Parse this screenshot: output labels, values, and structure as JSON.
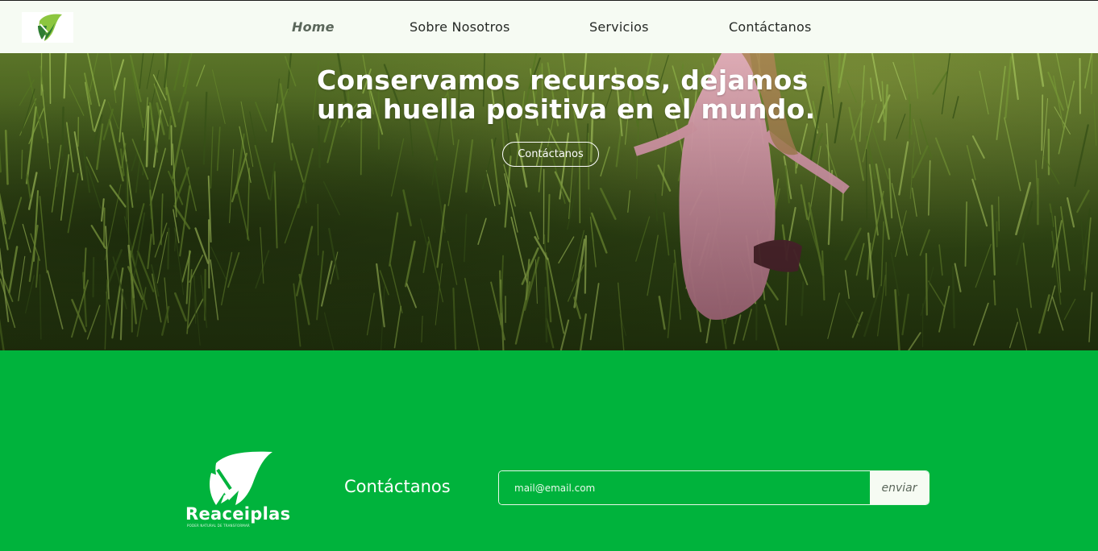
{
  "nav": {
    "logo_icon": "leaf-arrow-icon",
    "links": [
      {
        "label": "Home",
        "active": true
      },
      {
        "label": "Sobre Nosotros",
        "active": false
      },
      {
        "label": "Servicios",
        "active": false
      },
      {
        "label": "Contáctanos",
        "active": false
      }
    ]
  },
  "hero": {
    "title_line1": "Conservamos recursos, dejamos",
    "title_line2": "una huella positiva en el mundo.",
    "button_label": "Contáctanos",
    "image": "girl-in-pink-dress-running-through-grass-field"
  },
  "footer": {
    "brand_name": "Reaceiplas",
    "brand_tagline": "PODER NATURAL DE TRANSFORMAR",
    "contact_heading": "Contáctanos",
    "email_placeholder": "mail@email.com",
    "send_label": "enviar"
  },
  "colors": {
    "brand_green": "#00b33c",
    "nav_bg": "#f6fbf3",
    "leaf_light": "#8cc63f",
    "leaf_dark": "#2e7d32"
  }
}
